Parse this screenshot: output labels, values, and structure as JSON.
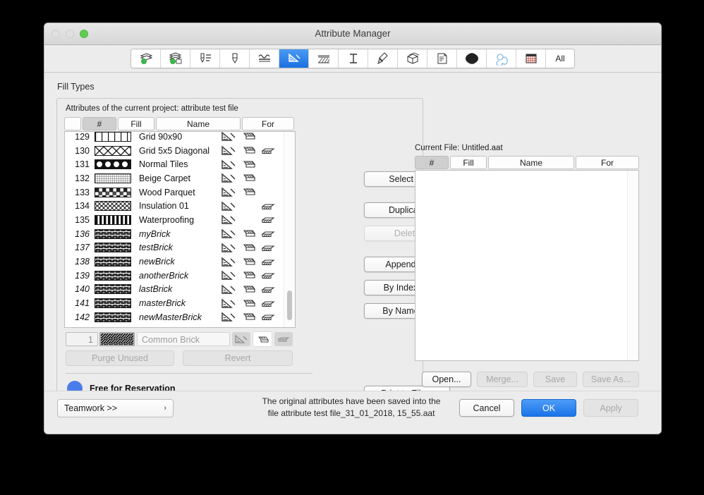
{
  "window": {
    "title": "Attribute Manager",
    "traffic_lights": [
      "close-button",
      "minimize-button",
      "zoom-button"
    ]
  },
  "toolbar": {
    "items": [
      {
        "name": "building-materials-icon",
        "label": "Building Materials",
        "selected": false
      },
      {
        "name": "composites-icon",
        "label": "Composites",
        "selected": false
      },
      {
        "name": "pen-sets-icon",
        "label": "Pen Sets",
        "selected": false
      },
      {
        "name": "pens-icon",
        "label": "Pens",
        "selected": false
      },
      {
        "name": "line-types-icon",
        "label": "Line Types",
        "selected": false
      },
      {
        "name": "fill-types-icon",
        "label": "Fill Types",
        "selected": true
      },
      {
        "name": "surfaces-icon",
        "label": "Surfaces",
        "selected": false
      },
      {
        "name": "profiles-icon",
        "label": "Profiles",
        "selected": false
      },
      {
        "name": "markup-styles-icon",
        "label": "Markup Styles",
        "selected": false
      },
      {
        "name": "zones-icon",
        "label": "Zone Categories",
        "selected": false
      },
      {
        "name": "layers-icon",
        "label": "Layers",
        "selected": false
      },
      {
        "name": "mep-systems-icon",
        "label": "MEP Systems",
        "selected": false
      },
      {
        "name": "operation-profiles-icon",
        "label": "Operation Profiles",
        "selected": false
      },
      {
        "name": "schedule-icon",
        "label": "Schedules",
        "selected": false
      }
    ],
    "all_label": "All"
  },
  "section": {
    "label": "Fill Types"
  },
  "left_panel": {
    "title": "Attributes of the current project: attribute test file",
    "columns": [
      "",
      "#",
      "Fill",
      "Name",
      "For"
    ],
    "rows": [
      {
        "num": "129",
        "name": "Grid 90x90",
        "pattern": "vbars",
        "italic": false,
        "for": [
          true,
          true,
          false
        ],
        "clipped": true
      },
      {
        "num": "130",
        "name": "Grid 5x5 Diagonal",
        "pattern": "diagonalx",
        "italic": false,
        "for": [
          true,
          true,
          true
        ]
      },
      {
        "num": "131",
        "name": "Normal Tiles",
        "pattern": "tiles",
        "italic": false,
        "for": [
          true,
          true,
          false
        ]
      },
      {
        "num": "132",
        "name": "Beige Carpet",
        "pattern": "carpet",
        "italic": false,
        "for": [
          true,
          true,
          false
        ]
      },
      {
        "num": "133",
        "name": "Wood Parquet",
        "pattern": "parquet",
        "italic": false,
        "for": [
          true,
          true,
          false
        ]
      },
      {
        "num": "134",
        "name": "Insulation 01",
        "pattern": "insul",
        "italic": false,
        "for": [
          true,
          false,
          true
        ]
      },
      {
        "num": "135",
        "name": "Waterproofing",
        "pattern": "vthick",
        "italic": false,
        "for": [
          true,
          false,
          true
        ]
      },
      {
        "num": "136",
        "name": "myBrick",
        "pattern": "brick",
        "italic": true,
        "for": [
          true,
          true,
          true
        ]
      },
      {
        "num": "137",
        "name": "testBrick",
        "pattern": "brick",
        "italic": true,
        "for": [
          true,
          true,
          true
        ]
      },
      {
        "num": "138",
        "name": "newBrick",
        "pattern": "brick",
        "italic": true,
        "for": [
          true,
          true,
          true
        ]
      },
      {
        "num": "139",
        "name": "anotherBrick",
        "pattern": "brick",
        "italic": true,
        "for": [
          true,
          true,
          true
        ]
      },
      {
        "num": "140",
        "name": "lastBrick",
        "pattern": "brick",
        "italic": true,
        "for": [
          true,
          true,
          true
        ]
      },
      {
        "num": "141",
        "name": "masterBrick",
        "pattern": "brick",
        "italic": true,
        "for": [
          true,
          true,
          true
        ]
      },
      {
        "num": "142",
        "name": "newMasterBrick",
        "pattern": "brick",
        "italic": true,
        "for": [
          true,
          true,
          true
        ]
      }
    ],
    "edit_row": {
      "index_value": "1",
      "name_value": "",
      "name_placeholder": "Common Brick",
      "for_states": [
        "on",
        "off",
        "on"
      ]
    },
    "buttons": {
      "purge_unused": "Purge Unused",
      "revert": "Revert"
    },
    "reservation": {
      "label": "Free for Reservation",
      "color": "#4a7dea"
    }
  },
  "middle_buttons": {
    "select_all": "Select All",
    "duplicate": "Duplicate",
    "delete": "Delete",
    "append": "Append >>",
    "by_index": "By Index >>",
    "by_name": "By Name >>",
    "print_to_file": "Print to File..."
  },
  "right_panel": {
    "title": "Current File: Untitled.aat",
    "columns": [
      "#",
      "Fill",
      "Name",
      "For"
    ],
    "rows": [],
    "buttons": {
      "open": "Open...",
      "merge": "Merge...",
      "save": "Save",
      "save_as": "Save As..."
    }
  },
  "footer": {
    "teamwork": "Teamwork >>",
    "teamwork_arrow": "›",
    "message_line1": "The original attributes have been saved into the",
    "message_line2": "file attribute test file_31_01_2018, 15_55.aat",
    "cancel": "Cancel",
    "ok": "OK",
    "apply": "Apply"
  },
  "colors": {
    "accent": "#1a74e8",
    "selection": "#2d80e8",
    "reservation": "#4a7dea",
    "window_bg": "#ececec"
  }
}
